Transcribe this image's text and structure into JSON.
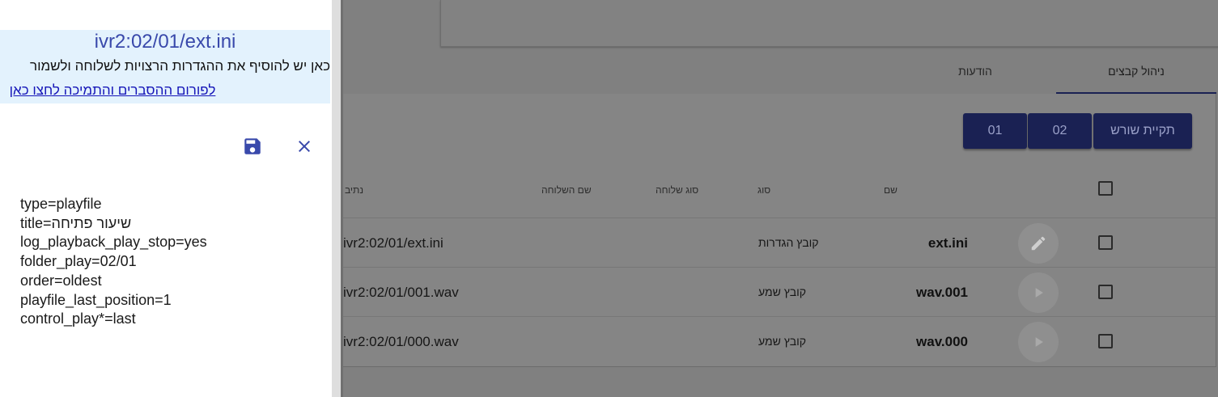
{
  "editor": {
    "file_title": "ivr2:02/01/ext.ini",
    "info_text": "כאן יש להוסיף את ההגדרות הרצויות לשלוחה ולשמור",
    "forum_link": "לפורום ההסברים והתמיכה לחצו כאן",
    "lines": [
      "type=playfile",
      "title=שיעור פתיחה",
      "log_playback_play_stop=yes",
      "folder_play=02/01",
      "order=oldest",
      "playfile_last_position=1",
      "control_play*=last"
    ]
  },
  "tabs": {
    "files": "ניהול קבצים",
    "messages": "הודעות"
  },
  "breadcrumbs": [
    "תקיית שורש",
    "02",
    "01"
  ],
  "table": {
    "headers": {
      "name": "שם",
      "type": "סוג",
      "ext_type": "סוג שלוחה",
      "ext_name": "שם השלוחה",
      "path": "נתיב"
    },
    "rows": [
      {
        "name": "ext.ini",
        "type": "קובץ הגדרות",
        "path": "ivr2:02/01/ext.ini",
        "action": "edit-icon"
      },
      {
        "name": "wav.001",
        "type": "קובץ שמע",
        "path": "ivr2:02/01/001.wav",
        "action": "play-icon"
      },
      {
        "name": "wav.000",
        "type": "קובץ שמע",
        "path": "ivr2:02/01/000.wav",
        "action": "play-icon"
      }
    ]
  },
  "colors": {
    "accent": "#3949ab",
    "primary_dark": "#1a2153",
    "info_bg": "#e3f2fd",
    "link": "#1515b8"
  }
}
